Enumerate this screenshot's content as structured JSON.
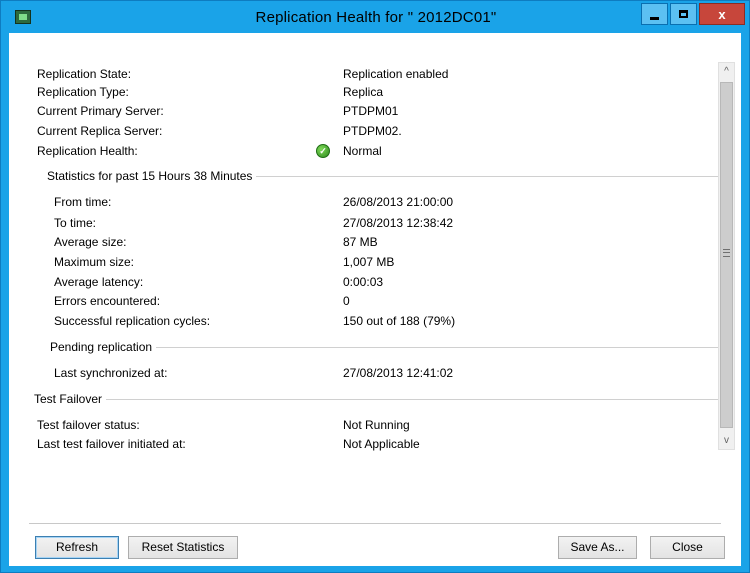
{
  "window": {
    "title": "Replication Health for \"    2012DC01\"",
    "accent_color": "#1aa3e8",
    "close_color": "#c7463b",
    "icons": {
      "app": "server-icon",
      "minimize": "minimize-icon",
      "maximize": "maximize-icon",
      "close": "close-icon"
    },
    "close_glyph": "x"
  },
  "summary": [
    {
      "label": "Replication State:",
      "value": "Replication enabled"
    },
    {
      "label": "Replication Type:",
      "value": "Replica"
    },
    {
      "label": "Current Primary Server:",
      "value": "PTDPM01"
    },
    {
      "label": "Current Replica Server:",
      "value": "PTDPM02."
    },
    {
      "label": "Replication Health:",
      "value": "Normal",
      "icon": "check-ok-icon"
    }
  ],
  "statistics": {
    "heading": "Statistics for past 15 Hours 38 Minutes",
    "rows": [
      {
        "label": "From time:",
        "value": "26/08/2013 21:00:00"
      },
      {
        "label": "To time:",
        "value": "27/08/2013 12:38:42"
      },
      {
        "label": "Average size:",
        "value": "87 MB"
      },
      {
        "label": "Maximum size:",
        "value": "1,007 MB"
      },
      {
        "label": "Average latency:",
        "value": "0:00:03"
      },
      {
        "label": "Errors encountered:",
        "value": "0"
      },
      {
        "label": "Successful replication cycles:",
        "value": "150 out of 188 (79%)"
      }
    ]
  },
  "pending": {
    "heading": "Pending replication",
    "rows": [
      {
        "label": "Last synchronized at:",
        "value": "27/08/2013 12:41:02"
      }
    ]
  },
  "test_failover": {
    "heading": "Test Failover",
    "rows": [
      {
        "label": "Test failover status:",
        "value": "Not Running"
      },
      {
        "label": "Last test failover initiated at:",
        "value": "Not Applicable"
      }
    ]
  },
  "scrollbar": {
    "up_glyph": "^",
    "down_glyph": "v"
  },
  "buttons": {
    "refresh": "Refresh",
    "reset_statistics": "Reset Statistics",
    "save_as": "Save As...",
    "close": "Close"
  }
}
